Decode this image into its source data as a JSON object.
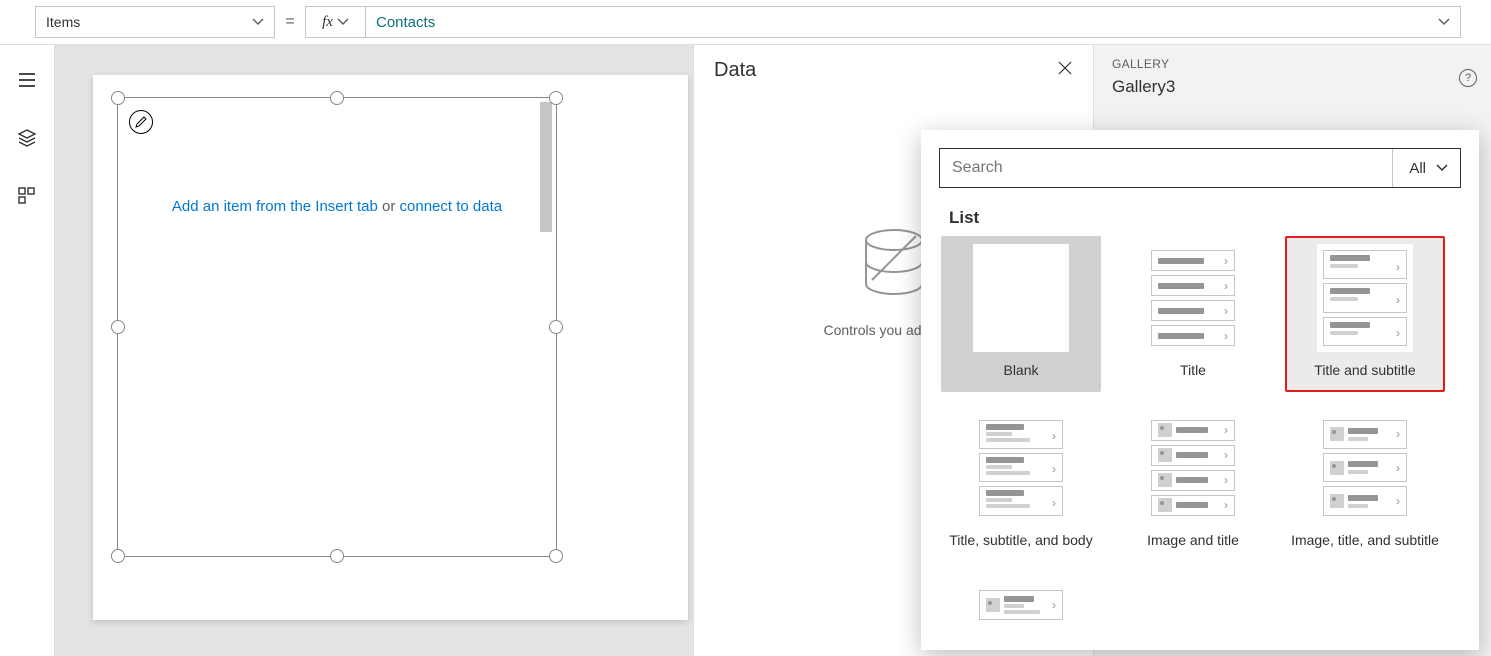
{
  "formulaBar": {
    "property": "Items",
    "value": "Contacts"
  },
  "canvas": {
    "hintInsert": "Add an item from the Insert tab",
    "hintOr": " or ",
    "hintConnect": "connect to data"
  },
  "dataPanel": {
    "title": "Data",
    "message": "Controls you add will s"
  },
  "rightPanel": {
    "label": "GALLERY",
    "name": "Gallery3"
  },
  "layoutPicker": {
    "searchPlaceholder": "Search",
    "filter": "All",
    "sectionTitle": "List",
    "tiles": [
      {
        "caption": "Blank",
        "type": "blank"
      },
      {
        "caption": "Title",
        "type": "title"
      },
      {
        "caption": "Title and subtitle",
        "type": "titlesub",
        "highlight": true
      },
      {
        "caption": "Title, subtitle, and body",
        "type": "titlesubbody"
      },
      {
        "caption": "Image and title",
        "type": "imgtitle"
      },
      {
        "caption": "Image, title, and subtitle",
        "type": "imgtitlesub"
      }
    ]
  }
}
